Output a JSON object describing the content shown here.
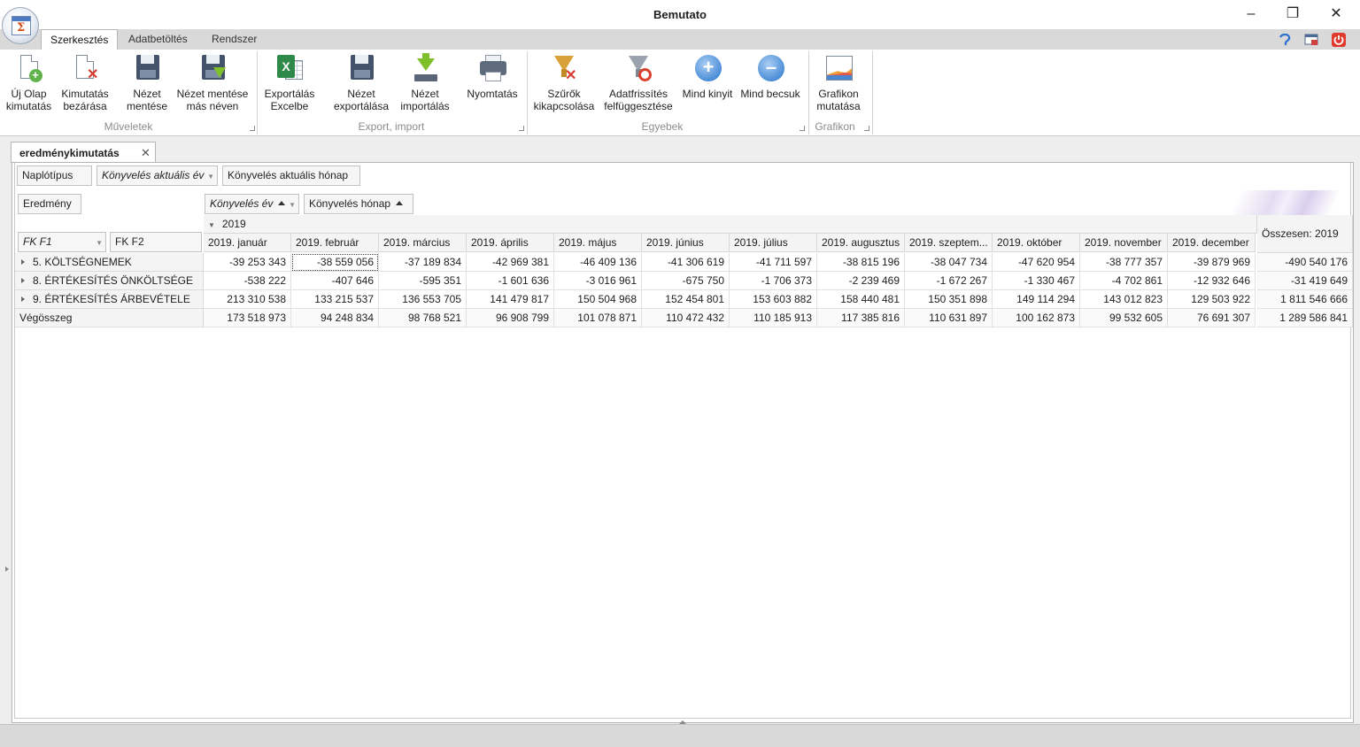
{
  "window": {
    "title": "Bemutato",
    "minimize": "–",
    "restore": "❐",
    "close": "✕"
  },
  "ribbon_tabs": [
    "Szerkesztés",
    "Adatbetöltés",
    "Rendszer"
  ],
  "ribbon": {
    "groups": [
      "Műveletek",
      "Export, import",
      "Egyebek",
      "Grafikon"
    ],
    "buttons": {
      "new_sheet": [
        "Új Olap",
        "kimutatás"
      ],
      "close_report": [
        "Kimutatás",
        "bezárása"
      ],
      "save_view": [
        "Nézet",
        "mentése"
      ],
      "save_view_as": [
        "Nézet mentése",
        "más néven"
      ],
      "export_excel": [
        "Exportálás",
        "Excelbe"
      ],
      "export_view": [
        "Nézet",
        "exportálása"
      ],
      "import_view": [
        "Nézet",
        "importálás"
      ],
      "print": "Nyomtatás",
      "filters_off": [
        "Szűrők",
        "kikapcsolása"
      ],
      "suspend_refresh": [
        "Adatfrissítés",
        "felfüggesztése"
      ],
      "expand_all": "Mind kinyit",
      "collapse_all": "Mind becsuk",
      "show_chart": [
        "Grafikon",
        "mutatása"
      ]
    }
  },
  "document_tab": "eredménykimutatás",
  "pivot": {
    "filter_fields": [
      "Naplótípus",
      "Könyvelés aktuális év",
      "Könyvelés aktuális hónap"
    ],
    "data_field": "Eredmény",
    "column_fields": [
      "Könyvelés év",
      "Könyvelés hónap"
    ],
    "row_fields": [
      "FK F1",
      "FK F2"
    ],
    "year": "2019",
    "columns": [
      "2019. január",
      "2019. február",
      "2019. március",
      "2019. április",
      "2019. május",
      "2019. június",
      "2019. július",
      "2019. augusztus",
      "2019. szeptem...",
      "2019. október",
      "2019. november",
      "2019. december"
    ],
    "total_column": "Összesen: 2019",
    "rows": [
      {
        "label": "5. KÖLTSÉGNEMEK",
        "values": [
          "-39 253 343",
          "-38 559 056",
          "-37 189 834",
          "-42 969 381",
          "-46 409 136",
          "-41 306 619",
          "-41 711 597",
          "-38 815 196",
          "-38 047 734",
          "-47 620 954",
          "-38 777 357",
          "-39 879 969"
        ],
        "total": "-490 540 176"
      },
      {
        "label": "8. ÉRTÉKESÍTÉS ÖNKÖLTSÉGE",
        "values": [
          "-538 222",
          "-407 646",
          "-595 351",
          "-1 601 636",
          "-3 016 961",
          "-675 750",
          "-1 706 373",
          "-2 239 469",
          "-1 672 267",
          "-1 330 467",
          "-4 702 861",
          "-12 932 646"
        ],
        "total": "-31 419 649"
      },
      {
        "label": "9. ÉRTÉKESÍTÉS ÁRBEVÉTELE",
        "values": [
          "213 310 538",
          "133 215 537",
          "136 553 705",
          "141 479 817",
          "150 504 968",
          "152 454 801",
          "153 603 882",
          "158 440 481",
          "150 351 898",
          "149 114 294",
          "143 012 823",
          "129 503 922"
        ],
        "total": "1 811 546 666"
      }
    ],
    "grand_total": {
      "label": "Végösszeg",
      "values": [
        "173 518 973",
        "94 248 834",
        "98 768 521",
        "96 908 799",
        "101 078 871",
        "110 472 432",
        "110 185 913",
        "117 385 816",
        "110 631 897",
        "100 162 873",
        "99 532 605",
        "76 691 307"
      ],
      "total": "1 289 586 841"
    }
  }
}
